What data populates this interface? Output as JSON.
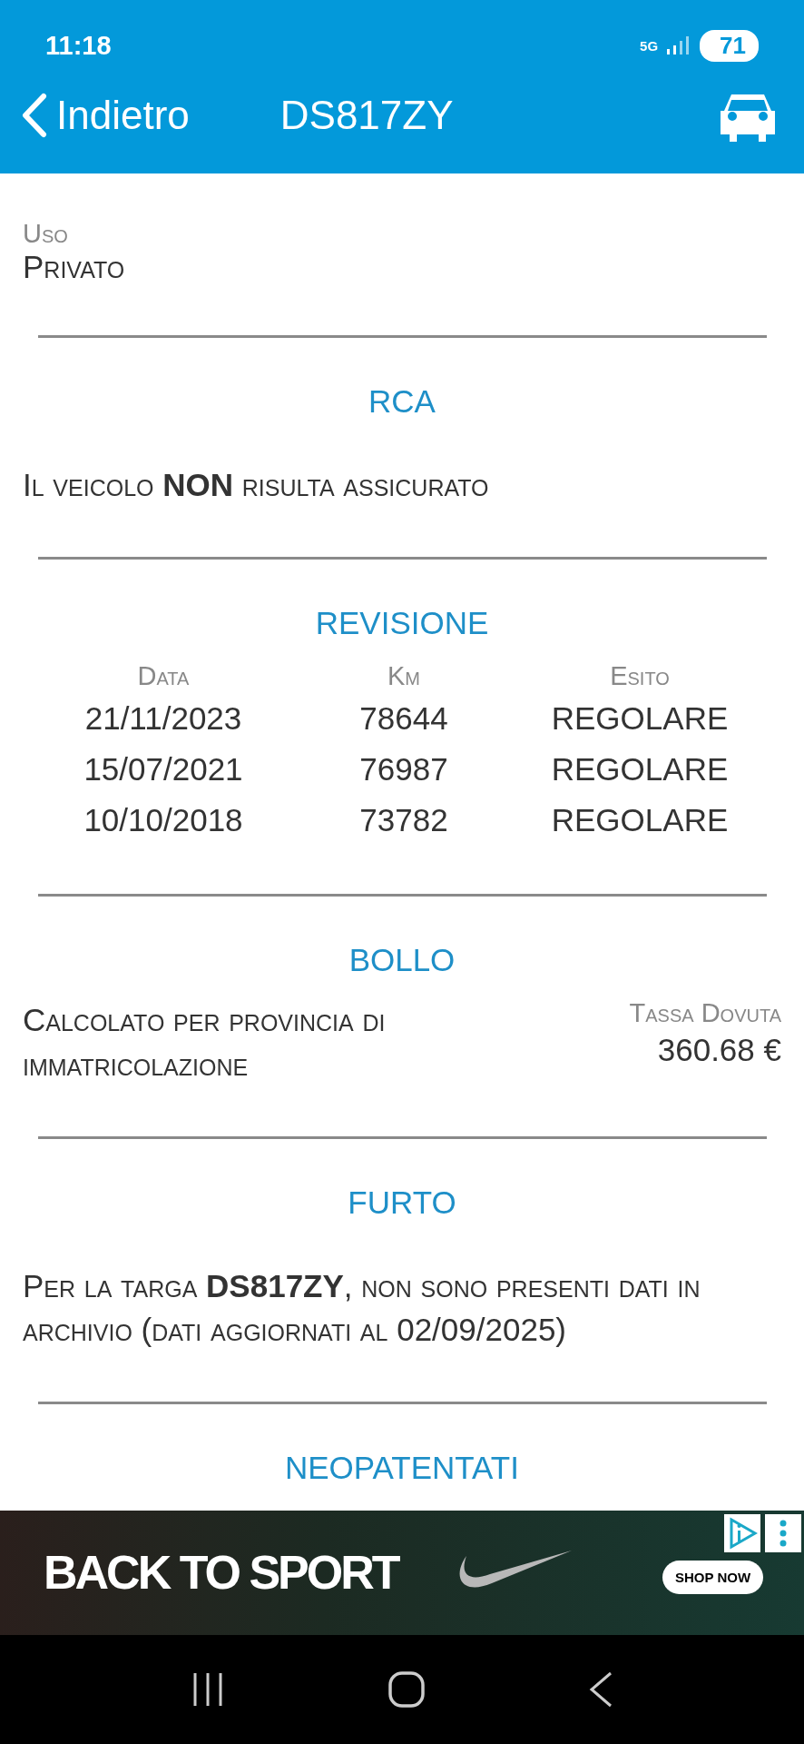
{
  "status_bar": {
    "time": "11:18",
    "network": "5G",
    "battery": "71"
  },
  "toolbar": {
    "back": "Indietro",
    "title": "DS817ZY"
  },
  "usage": {
    "label": "Uso",
    "value": "Privato"
  },
  "sections": [
    {
      "kind": "text",
      "title": "RCA",
      "text": "Il veicolo **NON** risulta assicurato"
    },
    {
      "kind": "table",
      "title": "REVISIONE",
      "columns": [
        "Data",
        "Km",
        "Esito"
      ],
      "rows": [
        [
          "21/11/2023",
          "78644",
          "REGOLARE"
        ],
        [
          "15/07/2021",
          "76987",
          "REGOLARE"
        ],
        [
          "10/10/2018",
          "73782",
          "REGOLARE"
        ]
      ]
    },
    {
      "kind": "tax",
      "title": "BOLLO",
      "text": "Calcolato per provincia di immatricolazione",
      "amount_label": "Tassa Dovuta",
      "amount": "360.68 €"
    },
    {
      "kind": "text",
      "title": "FURTO",
      "text": "Per la targa **DS817ZY**, non sono presenti dati in archivio (dati aggiornati al 02/09/2025)"
    },
    {
      "kind": "heading",
      "title": "NEOPATENTATI"
    }
  ],
  "ad": {
    "headline": "BACK TO SPORT",
    "button": "SHOP NOW"
  }
}
